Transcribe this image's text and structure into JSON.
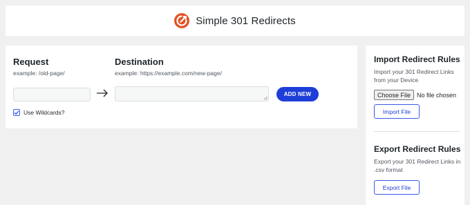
{
  "app": {
    "title": "Simple 301 Redirects",
    "icon": "redirect-logo-icon",
    "brand_color": "#e35323"
  },
  "redirect_form": {
    "request_label": "Request",
    "request_hint": "example: /old-page/",
    "request_value": "",
    "destination_label": "Destination",
    "destination_hint": "example: https://example.com/new-page/",
    "destination_value": "",
    "arrow_icon": "arrow-right-icon",
    "add_button_label": "ADD NEW",
    "wildcards_label": "Use Wildcards?",
    "wildcards_checked": true
  },
  "import": {
    "title": "Import Redirect Rules",
    "description": "Import your 301 Redirect Links from your Device",
    "choose_file_label": "Choose File",
    "no_file_text": "No file chosen",
    "button_label": "Import File"
  },
  "export": {
    "title": "Export Redirect Rules",
    "description": "Export your 301 Redirect Links in .csv format",
    "button_label": "Export File"
  },
  "colors": {
    "accent": "#1e3ed8",
    "background": "#f0f0f1",
    "card": "#ffffff"
  }
}
